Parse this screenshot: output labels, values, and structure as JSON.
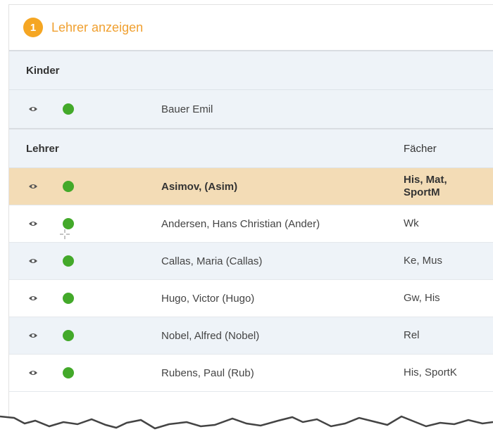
{
  "header": {
    "step_number": "1",
    "title": "Lehrer anzeigen"
  },
  "kinder": {
    "section_title": "Kinder",
    "items": [
      {
        "name": "Bauer Emil"
      }
    ]
  },
  "lehrer": {
    "section_title": "Lehrer",
    "subjects_header": "Fächer",
    "items": [
      {
        "name": "Asimov, (Asim)",
        "subjects": "His, Mat,\nSportM",
        "selected": true
      },
      {
        "name": "Andersen, Hans Christian (Ander)",
        "subjects": "Wk"
      },
      {
        "name": "Callas, Maria (Callas)",
        "subjects": "Ke, Mus"
      },
      {
        "name": "Hugo, Victor (Hugo)",
        "subjects": "Gw, His"
      },
      {
        "name": "Nobel, Alfred (Nobel)",
        "subjects": "Rel"
      },
      {
        "name": "Rubens, Paul (Rub)",
        "subjects": "His, SportK"
      }
    ]
  },
  "colors": {
    "accent": "#f5a623",
    "status_active": "#43a92a",
    "selected_row": "#f3dcb6",
    "row_alt": "#eef3f8"
  },
  "icons": {
    "view": "eye-icon",
    "status": "status-dot-icon"
  }
}
